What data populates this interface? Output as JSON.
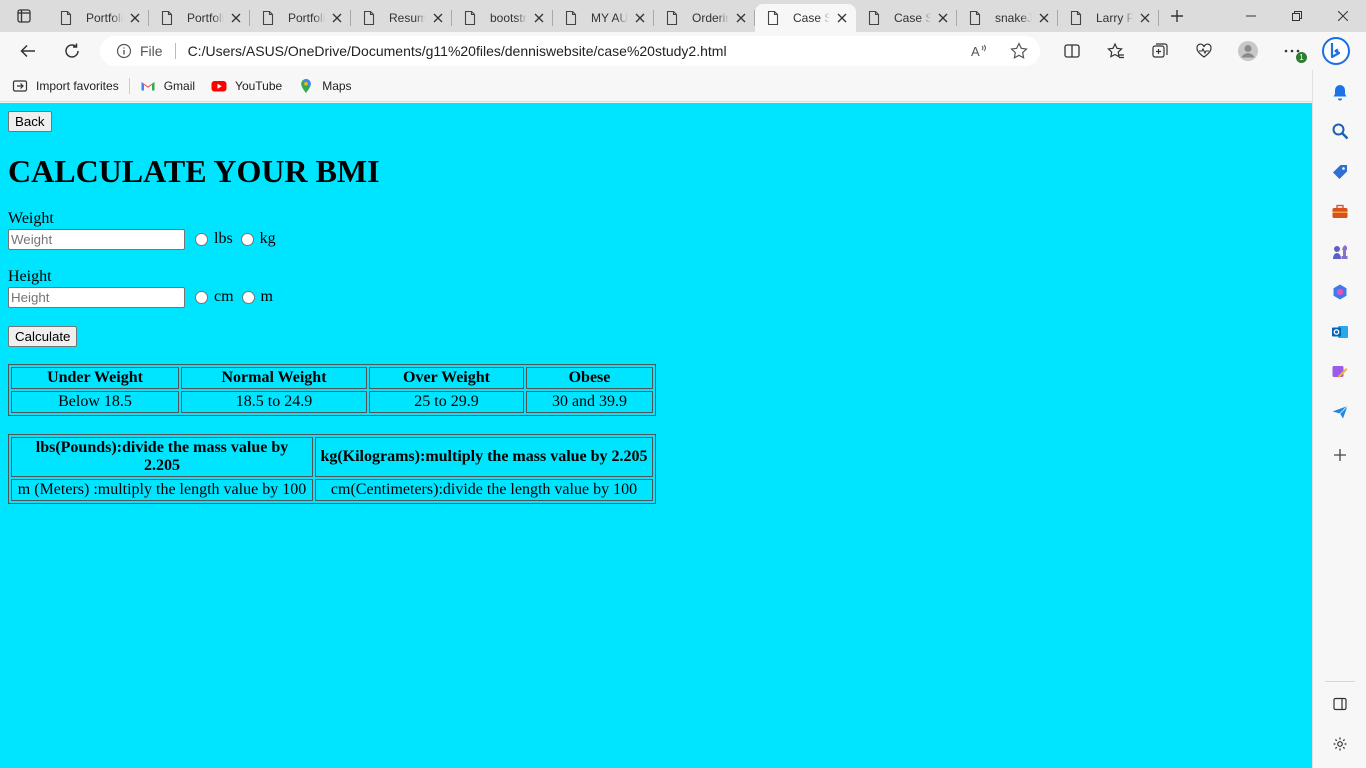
{
  "browser": {
    "tabs": [
      {
        "title": "Portfolio",
        "active": false
      },
      {
        "title": "Portfolio",
        "active": false
      },
      {
        "title": "Portfolio",
        "active": false
      },
      {
        "title": "Resume",
        "active": false
      },
      {
        "title": "bootstrap",
        "active": false
      },
      {
        "title": "MY AU",
        "active": false
      },
      {
        "title": "Ordering",
        "active": false
      },
      {
        "title": "Case Study",
        "active": true
      },
      {
        "title": "Case Study",
        "active": false
      },
      {
        "title": "snakeJS",
        "active": false
      },
      {
        "title": "Larry P",
        "active": false
      }
    ],
    "address": {
      "scheme_label": "File",
      "url": "C:/Users/ASUS/OneDrive/Documents/g11%20files/denniswebsite/case%20study2.html"
    },
    "favorites": [
      {
        "label": "Import favorites",
        "icon": "import-icon"
      },
      {
        "label": "Gmail",
        "icon": "gmail-icon"
      },
      {
        "label": "YouTube",
        "icon": "youtube-icon"
      },
      {
        "label": "Maps",
        "icon": "maps-icon"
      }
    ],
    "extensions_badge": "1"
  },
  "page": {
    "background": "#00e5ff",
    "back_button": "Back",
    "heading": "CALCULATE YOUR BMI",
    "weight": {
      "label": "Weight",
      "placeholder": "Weight",
      "units": [
        "lbs",
        "kg"
      ]
    },
    "height": {
      "label": "Height",
      "placeholder": "Height",
      "units": [
        "cm",
        "m"
      ]
    },
    "calculate_button": "Calculate",
    "bmi_table": {
      "headers": [
        "Under Weight",
        "Normal Weight",
        "Over Weight",
        "Obese"
      ],
      "values": [
        "Below 18.5",
        "18.5 to 24.9",
        "25 to 29.9",
        "30 and 39.9"
      ]
    },
    "conversion_table": {
      "headers": [
        "lbs(Pounds):divide the mass value by 2.205",
        "kg(Kilograms):multiply the mass value by 2.205"
      ],
      "values": [
        "m (Meters) :multiply the length value by 100",
        "cm(Centimeters):divide the length value by 100"
      ]
    }
  }
}
